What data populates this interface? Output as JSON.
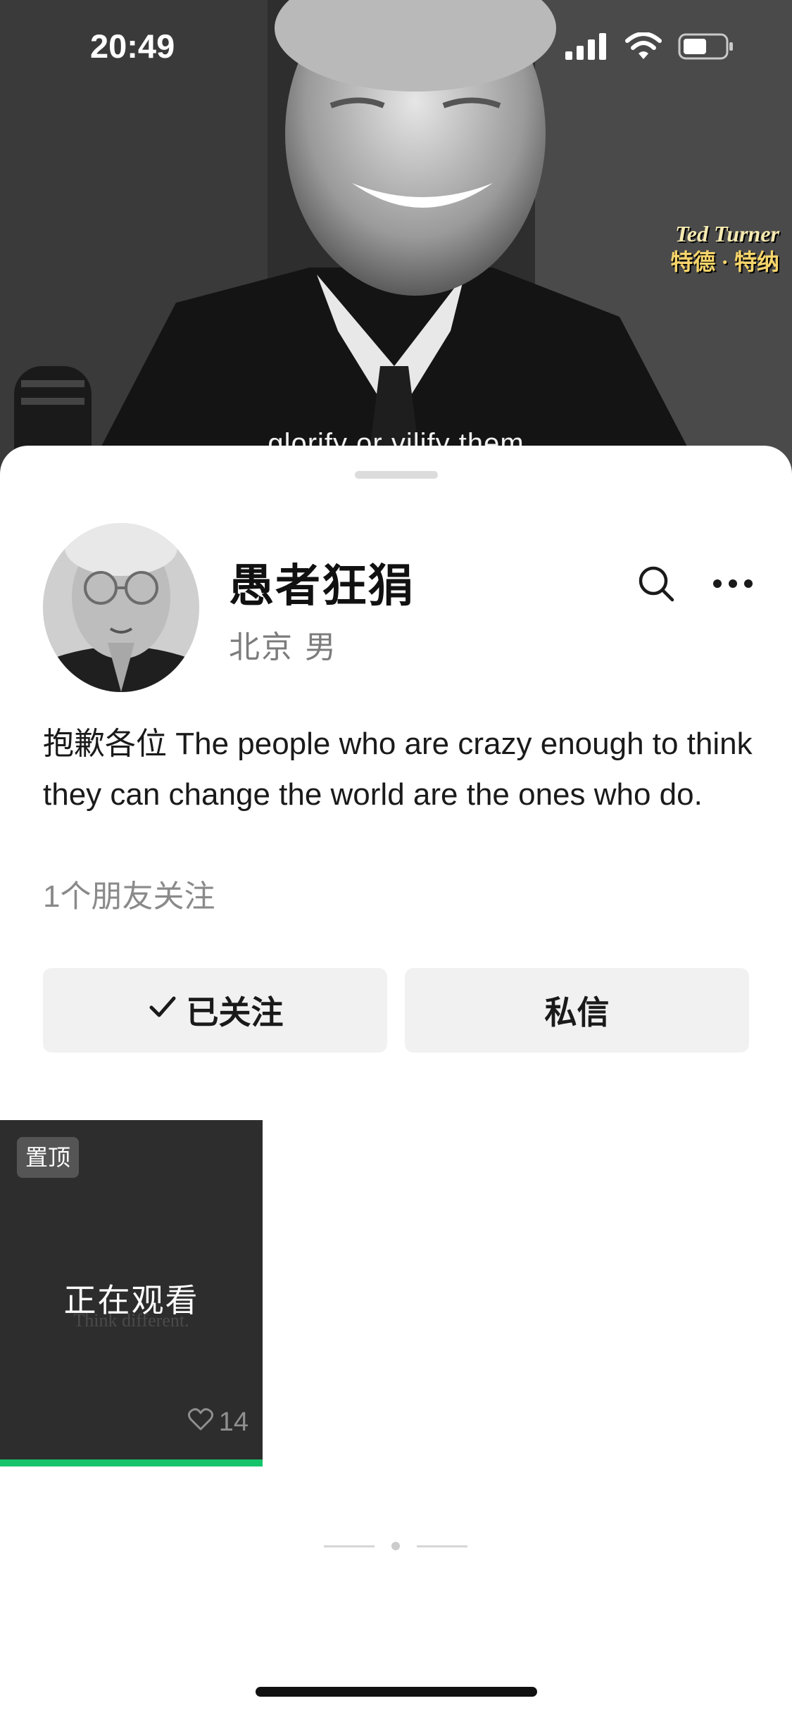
{
  "status_bar": {
    "time": "20:49"
  },
  "background_video": {
    "caption": "glorify or vilify them",
    "name_tag_en": "Ted Turner",
    "name_tag_zh": "特德 · 特纳"
  },
  "profile": {
    "name": "愚者狂狷",
    "meta": "北京 男",
    "bio": "抱歉各位 The people who are crazy enough to think they can change the world are the ones who do.",
    "friends_follow": "1个朋友关注"
  },
  "actions": {
    "follow_label": "已关注",
    "message_label": "私信"
  },
  "videos": [
    {
      "pinned_label": "置顶",
      "status_label": "正在观看",
      "background_text": "Think different.",
      "likes": "14",
      "progress": 1.0
    }
  ],
  "colors": {
    "accent_green": "#15c46a",
    "button_bg": "#f1f1f1",
    "tile_bg": "#2d2d2d"
  },
  "icons": {
    "search": "search-icon",
    "more": "more-dots-icon",
    "check": "check-icon",
    "heart": "heart-icon",
    "signal": "signal-icon",
    "wifi": "wifi-icon",
    "battery": "battery-icon"
  }
}
